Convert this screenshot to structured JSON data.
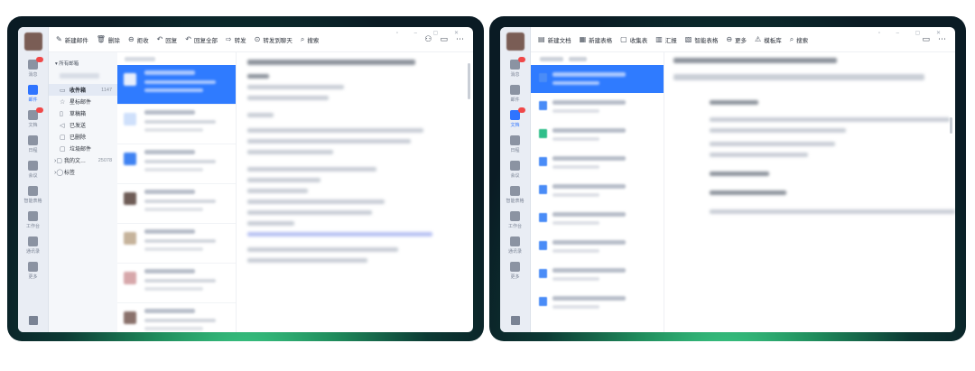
{
  "left_window": {
    "toolbar": [
      {
        "icon": "compose-icon",
        "glyph": "✎",
        "label": "新建邮件"
      },
      {
        "icon": "trash-icon",
        "glyph": "🗑",
        "label": "删除"
      },
      {
        "icon": "reject-icon",
        "glyph": "⊖",
        "label": "拒收"
      },
      {
        "icon": "reply-icon",
        "glyph": "↶",
        "label": "回复"
      },
      {
        "icon": "reply-all-icon",
        "glyph": "↶",
        "label": "回复全部"
      },
      {
        "icon": "forward-icon",
        "glyph": "⇨",
        "label": "转发"
      },
      {
        "icon": "chat-icon",
        "glyph": "⊙",
        "label": "转发到聊天"
      },
      {
        "icon": "search-icon",
        "glyph": "⌕",
        "label": "搜索"
      }
    ],
    "rail": [
      {
        "icon": "message-icon",
        "label": "消息"
      },
      {
        "icon": "mail-icon",
        "label": "邮件",
        "active": true
      },
      {
        "icon": "docs-icon",
        "label": "文档"
      },
      {
        "icon": "calendar-icon",
        "label": "日程"
      },
      {
        "icon": "meeting-icon",
        "label": "会议"
      },
      {
        "icon": "smart-sheet-icon",
        "label": "智能表格"
      },
      {
        "icon": "workbench-icon",
        "label": "工作台"
      },
      {
        "icon": "contacts-icon",
        "label": "通讯录"
      },
      {
        "icon": "more-icon",
        "label": "更多"
      }
    ],
    "folders": {
      "header": "所有邮箱",
      "items": [
        {
          "icon": "inbox-icon",
          "glyph": "▭",
          "label": "收件箱",
          "count": "1147",
          "selected": true
        },
        {
          "icon": "star-icon",
          "glyph": "☆",
          "label": "星标邮件"
        },
        {
          "icon": "drafts-icon",
          "glyph": "▯",
          "label": "草稿箱"
        },
        {
          "icon": "sent-icon",
          "glyph": "◁",
          "label": "已发送"
        },
        {
          "icon": "deleted-icon",
          "glyph": "▢",
          "label": "已删除"
        },
        {
          "icon": "spam-icon",
          "glyph": "▢",
          "label": "垃圾邮件"
        }
      ],
      "groups": [
        {
          "label": "我的文…",
          "count": "25078"
        },
        {
          "label": "标签"
        }
      ]
    }
  },
  "right_window": {
    "toolbar": [
      {
        "icon": "new-doc-icon",
        "glyph": "▤",
        "label": "新建文档"
      },
      {
        "icon": "new-sheet-icon",
        "glyph": "▦",
        "label": "新建表格"
      },
      {
        "icon": "collect-icon",
        "glyph": "▢",
        "label": "收集表"
      },
      {
        "icon": "report-icon",
        "glyph": "▥",
        "label": "汇报"
      },
      {
        "icon": "smart-sheet-icon",
        "glyph": "▧",
        "label": "智能表格"
      },
      {
        "icon": "more-icon",
        "glyph": "⊖",
        "label": "更多"
      },
      {
        "icon": "template-icon",
        "glyph": "⚠",
        "label": "模板库"
      },
      {
        "icon": "search-icon",
        "glyph": "⌕",
        "label": "搜索"
      }
    ],
    "rail": [
      {
        "icon": "message-icon",
        "label": "消息"
      },
      {
        "icon": "mail-icon",
        "label": "邮件"
      },
      {
        "icon": "docs-icon",
        "label": "文档",
        "active": true
      },
      {
        "icon": "calendar-icon",
        "label": "日程"
      },
      {
        "icon": "meeting-icon",
        "label": "会议"
      },
      {
        "icon": "smart-sheet-icon",
        "label": "智能表格"
      },
      {
        "icon": "workbench-icon",
        "label": "工作台"
      },
      {
        "icon": "contacts-icon",
        "label": "通讯录"
      },
      {
        "icon": "more-icon",
        "label": "更多"
      }
    ]
  },
  "colors": {
    "accent": "#2f7bff",
    "frame": "#0c3a34"
  }
}
